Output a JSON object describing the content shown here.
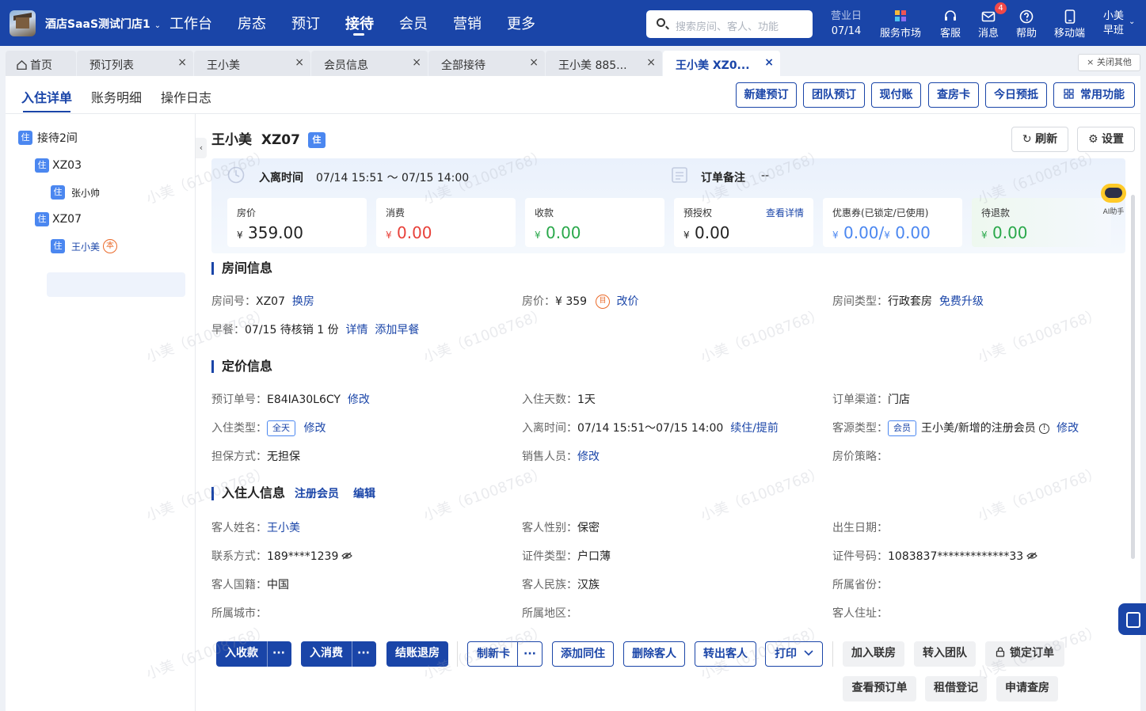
{
  "topbar": {
    "store_name": "酒店SaaS测试门店1",
    "nav": [
      "工作台",
      "房态",
      "预订",
      "接待",
      "会员",
      "营销",
      "更多"
    ],
    "active_nav": "接待",
    "search_placeholder": "搜索房间、客人、功能",
    "biz_day_label": "营业日",
    "biz_day_value": "07/14",
    "tools": [
      "服务市场",
      "客服",
      "消息",
      "帮助",
      "移动端"
    ],
    "message_badge": "4",
    "user_name": "小美",
    "user_shift": "早班"
  },
  "tabs": [
    {
      "label": "首页"
    },
    {
      "label": "预订列表"
    },
    {
      "label": "王小美"
    },
    {
      "label": "会员信息"
    },
    {
      "label": "全部接待"
    },
    {
      "label": "王小美 885..."
    },
    {
      "label": "王小美 XZ0..."
    }
  ],
  "close_others": "× 关闭其他",
  "subtabs": [
    "入住详单",
    "账务明细",
    "操作日志"
  ],
  "top_buttons": [
    "新建预订",
    "团队预订",
    "现付账",
    "查房卡",
    "今日预抵",
    "常用功能"
  ],
  "tree": {
    "root": "接待2间",
    "rooms": [
      {
        "room": "XZ03",
        "guest": "张小帅"
      },
      {
        "room": "XZ07",
        "guest": "王小美"
      }
    ],
    "tag": "住",
    "self_mark": "本"
  },
  "guest_header": {
    "title": "王小美  XZ07",
    "tag": "住",
    "refresh": "刷新",
    "settings": "设置"
  },
  "stay": {
    "label": "入离时间",
    "value": "07/14 15:51 ～ 07/15 14:00",
    "remark_label": "订单备注",
    "remark_value": "--"
  },
  "cards": [
    {
      "label": "房价",
      "value": "359.00",
      "currency": "¥",
      "color": "#222222"
    },
    {
      "label": "消费",
      "value": "0.00",
      "currency": "¥",
      "color": "#e8413a"
    },
    {
      "label": "收款",
      "value": "0.00",
      "currency": "¥",
      "color": "#29a84a"
    },
    {
      "label": "预授权",
      "value": "0.00",
      "currency": "¥",
      "color": "#222222",
      "link": "查看详情"
    },
    {
      "label": "优惠券(已锁定/已使用)",
      "value": "0.00/",
      "value2": "0.00",
      "currency": "¥",
      "color": "#4b87f0"
    },
    {
      "label": "待退款",
      "value": "0.00",
      "currency": "¥",
      "color": "#29a84a"
    }
  ],
  "room_info": {
    "title": "房间信息",
    "room_no_k": "房间号：",
    "room_no_v": "XZ07",
    "room_no_a": "换房",
    "price_k": "房价：",
    "price_v": "¥ 359",
    "price_icon": "目",
    "price_a": "改价",
    "type_k": "房间类型：",
    "type_v": "行政套房",
    "type_a": "免费升级",
    "breakfast_k": "早餐：",
    "breakfast_v": "07/15 待核销 1 份",
    "breakfast_a1": "详情",
    "breakfast_a2": "添加早餐"
  },
  "pricing": {
    "title": "定价信息",
    "order_k": "预订单号：",
    "order_v": "E84IA30L6CY",
    "order_a": "修改",
    "days_k": "入住天数：",
    "days_v": "1天",
    "channel_k": "订单渠道：",
    "channel_v": "门店",
    "stay_type_k": "入住类型：",
    "stay_type_badge": "全天",
    "stay_type_a": "修改",
    "time_k": "入离时间：",
    "time_v": "07/14 15:51～07/15 14:00",
    "time_a": "续住/提前",
    "source_k": "客源类型：",
    "source_badge": "会员",
    "source_v": "王小美/新增的注册会员",
    "source_a": "修改",
    "guarantee_k": "担保方式：",
    "guarantee_v": "无担保",
    "sales_k": "销售人员：",
    "sales_a": "修改",
    "strategy_k": "房价策略："
  },
  "guest": {
    "title": "入住人信息",
    "register": "注册会员",
    "edit": "编辑",
    "name_k": "客人姓名：",
    "name_v": "王小美",
    "gender_k": "客人性别：",
    "gender_v": "保密",
    "birth_k": "出生日期：",
    "phone_k": "联系方式：",
    "phone_v": "189****1239",
    "idtype_k": "证件类型：",
    "idtype_v": "户口薄",
    "idno_k": "证件号码：",
    "idno_v": "1083837*************33",
    "nation_k": "客人国籍：",
    "nation_v": "中国",
    "ethnic_k": "客人民族：",
    "ethnic_v": "汉族",
    "province_k": "所属省份：",
    "city_k": "所属城市：",
    "district_k": "所属地区：",
    "address_k": "客人住址："
  },
  "actions": {
    "primary": [
      "入收款",
      "入消费",
      "结账退房"
    ],
    "outline": [
      "制新卡",
      "添加同住",
      "删除客人",
      "转出客人",
      "打印"
    ],
    "gray": [
      "加入联房",
      "转入团队",
      "锁定订单",
      "查看预订单",
      "租借登记",
      "申请查房"
    ],
    "more": "···"
  },
  "ai_label": "AI助手",
  "watermark": "小美（61008768）"
}
